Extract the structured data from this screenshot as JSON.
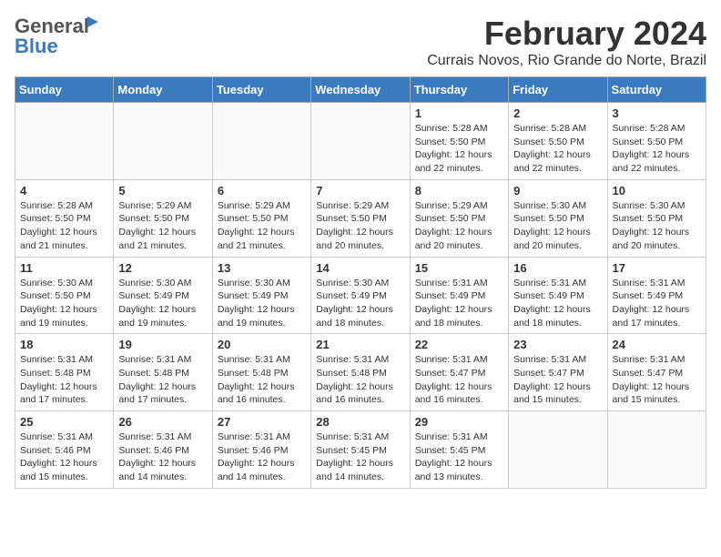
{
  "logo": {
    "general": "General",
    "blue": "Blue"
  },
  "header": {
    "month": "February 2024",
    "location": "Currais Novos, Rio Grande do Norte, Brazil"
  },
  "weekdays": [
    "Sunday",
    "Monday",
    "Tuesday",
    "Wednesday",
    "Thursday",
    "Friday",
    "Saturday"
  ],
  "weeks": [
    [
      {
        "day": "",
        "info": ""
      },
      {
        "day": "",
        "info": ""
      },
      {
        "day": "",
        "info": ""
      },
      {
        "day": "",
        "info": ""
      },
      {
        "day": "1",
        "info": "Sunrise: 5:28 AM\nSunset: 5:50 PM\nDaylight: 12 hours\nand 22 minutes."
      },
      {
        "day": "2",
        "info": "Sunrise: 5:28 AM\nSunset: 5:50 PM\nDaylight: 12 hours\nand 22 minutes."
      },
      {
        "day": "3",
        "info": "Sunrise: 5:28 AM\nSunset: 5:50 PM\nDaylight: 12 hours\nand 22 minutes."
      }
    ],
    [
      {
        "day": "4",
        "info": "Sunrise: 5:28 AM\nSunset: 5:50 PM\nDaylight: 12 hours\nand 21 minutes."
      },
      {
        "day": "5",
        "info": "Sunrise: 5:29 AM\nSunset: 5:50 PM\nDaylight: 12 hours\nand 21 minutes."
      },
      {
        "day": "6",
        "info": "Sunrise: 5:29 AM\nSunset: 5:50 PM\nDaylight: 12 hours\nand 21 minutes."
      },
      {
        "day": "7",
        "info": "Sunrise: 5:29 AM\nSunset: 5:50 PM\nDaylight: 12 hours\nand 20 minutes."
      },
      {
        "day": "8",
        "info": "Sunrise: 5:29 AM\nSunset: 5:50 PM\nDaylight: 12 hours\nand 20 minutes."
      },
      {
        "day": "9",
        "info": "Sunrise: 5:30 AM\nSunset: 5:50 PM\nDaylight: 12 hours\nand 20 minutes."
      },
      {
        "day": "10",
        "info": "Sunrise: 5:30 AM\nSunset: 5:50 PM\nDaylight: 12 hours\nand 20 minutes."
      }
    ],
    [
      {
        "day": "11",
        "info": "Sunrise: 5:30 AM\nSunset: 5:50 PM\nDaylight: 12 hours\nand 19 minutes."
      },
      {
        "day": "12",
        "info": "Sunrise: 5:30 AM\nSunset: 5:49 PM\nDaylight: 12 hours\nand 19 minutes."
      },
      {
        "day": "13",
        "info": "Sunrise: 5:30 AM\nSunset: 5:49 PM\nDaylight: 12 hours\nand 19 minutes."
      },
      {
        "day": "14",
        "info": "Sunrise: 5:30 AM\nSunset: 5:49 PM\nDaylight: 12 hours\nand 18 minutes."
      },
      {
        "day": "15",
        "info": "Sunrise: 5:31 AM\nSunset: 5:49 PM\nDaylight: 12 hours\nand 18 minutes."
      },
      {
        "day": "16",
        "info": "Sunrise: 5:31 AM\nSunset: 5:49 PM\nDaylight: 12 hours\nand 18 minutes."
      },
      {
        "day": "17",
        "info": "Sunrise: 5:31 AM\nSunset: 5:49 PM\nDaylight: 12 hours\nand 17 minutes."
      }
    ],
    [
      {
        "day": "18",
        "info": "Sunrise: 5:31 AM\nSunset: 5:48 PM\nDaylight: 12 hours\nand 17 minutes."
      },
      {
        "day": "19",
        "info": "Sunrise: 5:31 AM\nSunset: 5:48 PM\nDaylight: 12 hours\nand 17 minutes."
      },
      {
        "day": "20",
        "info": "Sunrise: 5:31 AM\nSunset: 5:48 PM\nDaylight: 12 hours\nand 16 minutes."
      },
      {
        "day": "21",
        "info": "Sunrise: 5:31 AM\nSunset: 5:48 PM\nDaylight: 12 hours\nand 16 minutes."
      },
      {
        "day": "22",
        "info": "Sunrise: 5:31 AM\nSunset: 5:47 PM\nDaylight: 12 hours\nand 16 minutes."
      },
      {
        "day": "23",
        "info": "Sunrise: 5:31 AM\nSunset: 5:47 PM\nDaylight: 12 hours\nand 15 minutes."
      },
      {
        "day": "24",
        "info": "Sunrise: 5:31 AM\nSunset: 5:47 PM\nDaylight: 12 hours\nand 15 minutes."
      }
    ],
    [
      {
        "day": "25",
        "info": "Sunrise: 5:31 AM\nSunset: 5:46 PM\nDaylight: 12 hours\nand 15 minutes."
      },
      {
        "day": "26",
        "info": "Sunrise: 5:31 AM\nSunset: 5:46 PM\nDaylight: 12 hours\nand 14 minutes."
      },
      {
        "day": "27",
        "info": "Sunrise: 5:31 AM\nSunset: 5:46 PM\nDaylight: 12 hours\nand 14 minutes."
      },
      {
        "day": "28",
        "info": "Sunrise: 5:31 AM\nSunset: 5:45 PM\nDaylight: 12 hours\nand 14 minutes."
      },
      {
        "day": "29",
        "info": "Sunrise: 5:31 AM\nSunset: 5:45 PM\nDaylight: 12 hours\nand 13 minutes."
      },
      {
        "day": "",
        "info": ""
      },
      {
        "day": "",
        "info": ""
      }
    ]
  ]
}
